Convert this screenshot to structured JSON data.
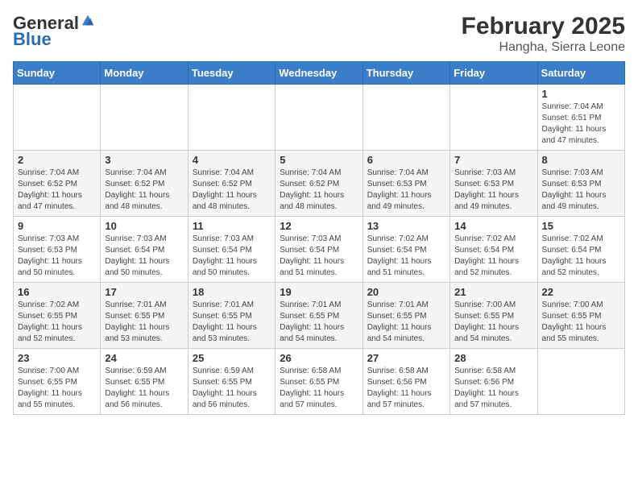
{
  "header": {
    "logo_general": "General",
    "logo_blue": "Blue",
    "month": "February 2025",
    "location": "Hangha, Sierra Leone"
  },
  "weekdays": [
    "Sunday",
    "Monday",
    "Tuesday",
    "Wednesday",
    "Thursday",
    "Friday",
    "Saturday"
  ],
  "weeks": [
    [
      {
        "day": null,
        "info": null
      },
      {
        "day": null,
        "info": null
      },
      {
        "day": null,
        "info": null
      },
      {
        "day": null,
        "info": null
      },
      {
        "day": null,
        "info": null
      },
      {
        "day": null,
        "info": null
      },
      {
        "day": "1",
        "info": "Sunrise: 7:04 AM\nSunset: 6:51 PM\nDaylight: 11 hours\nand 47 minutes."
      }
    ],
    [
      {
        "day": "2",
        "info": "Sunrise: 7:04 AM\nSunset: 6:52 PM\nDaylight: 11 hours\nand 47 minutes."
      },
      {
        "day": "3",
        "info": "Sunrise: 7:04 AM\nSunset: 6:52 PM\nDaylight: 11 hours\nand 48 minutes."
      },
      {
        "day": "4",
        "info": "Sunrise: 7:04 AM\nSunset: 6:52 PM\nDaylight: 11 hours\nand 48 minutes."
      },
      {
        "day": "5",
        "info": "Sunrise: 7:04 AM\nSunset: 6:52 PM\nDaylight: 11 hours\nand 48 minutes."
      },
      {
        "day": "6",
        "info": "Sunrise: 7:04 AM\nSunset: 6:53 PM\nDaylight: 11 hours\nand 49 minutes."
      },
      {
        "day": "7",
        "info": "Sunrise: 7:03 AM\nSunset: 6:53 PM\nDaylight: 11 hours\nand 49 minutes."
      },
      {
        "day": "8",
        "info": "Sunrise: 7:03 AM\nSunset: 6:53 PM\nDaylight: 11 hours\nand 49 minutes."
      }
    ],
    [
      {
        "day": "9",
        "info": "Sunrise: 7:03 AM\nSunset: 6:53 PM\nDaylight: 11 hours\nand 50 minutes."
      },
      {
        "day": "10",
        "info": "Sunrise: 7:03 AM\nSunset: 6:54 PM\nDaylight: 11 hours\nand 50 minutes."
      },
      {
        "day": "11",
        "info": "Sunrise: 7:03 AM\nSunset: 6:54 PM\nDaylight: 11 hours\nand 50 minutes."
      },
      {
        "day": "12",
        "info": "Sunrise: 7:03 AM\nSunset: 6:54 PM\nDaylight: 11 hours\nand 51 minutes."
      },
      {
        "day": "13",
        "info": "Sunrise: 7:02 AM\nSunset: 6:54 PM\nDaylight: 11 hours\nand 51 minutes."
      },
      {
        "day": "14",
        "info": "Sunrise: 7:02 AM\nSunset: 6:54 PM\nDaylight: 11 hours\nand 52 minutes."
      },
      {
        "day": "15",
        "info": "Sunrise: 7:02 AM\nSunset: 6:54 PM\nDaylight: 11 hours\nand 52 minutes."
      }
    ],
    [
      {
        "day": "16",
        "info": "Sunrise: 7:02 AM\nSunset: 6:55 PM\nDaylight: 11 hours\nand 52 minutes."
      },
      {
        "day": "17",
        "info": "Sunrise: 7:01 AM\nSunset: 6:55 PM\nDaylight: 11 hours\nand 53 minutes."
      },
      {
        "day": "18",
        "info": "Sunrise: 7:01 AM\nSunset: 6:55 PM\nDaylight: 11 hours\nand 53 minutes."
      },
      {
        "day": "19",
        "info": "Sunrise: 7:01 AM\nSunset: 6:55 PM\nDaylight: 11 hours\nand 54 minutes."
      },
      {
        "day": "20",
        "info": "Sunrise: 7:01 AM\nSunset: 6:55 PM\nDaylight: 11 hours\nand 54 minutes."
      },
      {
        "day": "21",
        "info": "Sunrise: 7:00 AM\nSunset: 6:55 PM\nDaylight: 11 hours\nand 54 minutes."
      },
      {
        "day": "22",
        "info": "Sunrise: 7:00 AM\nSunset: 6:55 PM\nDaylight: 11 hours\nand 55 minutes."
      }
    ],
    [
      {
        "day": "23",
        "info": "Sunrise: 7:00 AM\nSunset: 6:55 PM\nDaylight: 11 hours\nand 55 minutes."
      },
      {
        "day": "24",
        "info": "Sunrise: 6:59 AM\nSunset: 6:55 PM\nDaylight: 11 hours\nand 56 minutes."
      },
      {
        "day": "25",
        "info": "Sunrise: 6:59 AM\nSunset: 6:55 PM\nDaylight: 11 hours\nand 56 minutes."
      },
      {
        "day": "26",
        "info": "Sunrise: 6:58 AM\nSunset: 6:55 PM\nDaylight: 11 hours\nand 57 minutes."
      },
      {
        "day": "27",
        "info": "Sunrise: 6:58 AM\nSunset: 6:56 PM\nDaylight: 11 hours\nand 57 minutes."
      },
      {
        "day": "28",
        "info": "Sunrise: 6:58 AM\nSunset: 6:56 PM\nDaylight: 11 hours\nand 57 minutes."
      },
      {
        "day": null,
        "info": null
      }
    ]
  ]
}
